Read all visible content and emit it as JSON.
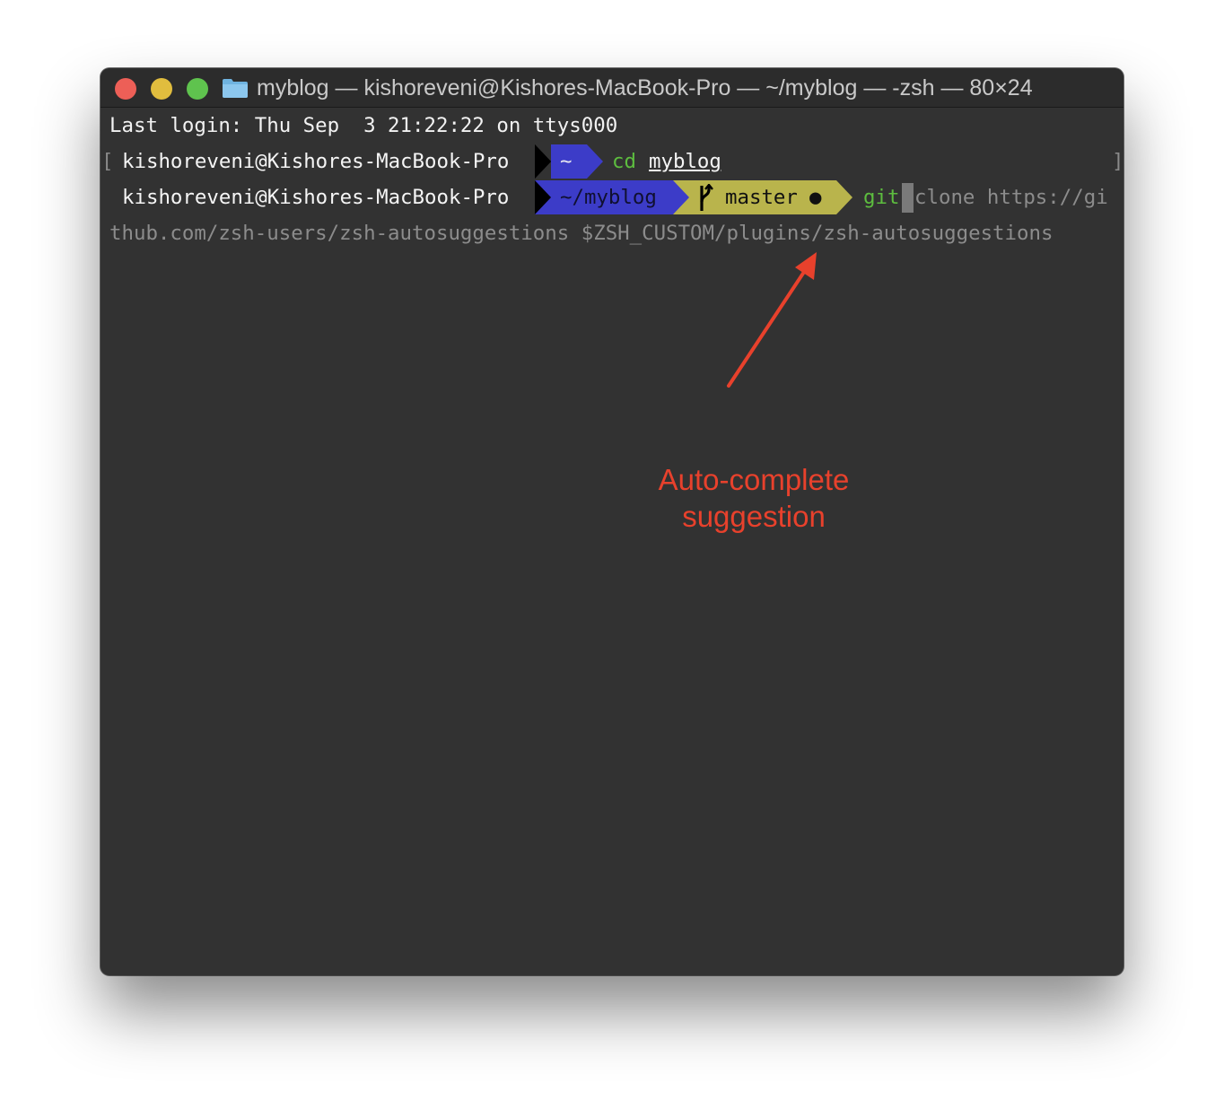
{
  "window": {
    "title": "myblog — kishoreveni@Kishores-MacBook-Pro — ~/myblog — -zsh — 80×24"
  },
  "terminal": {
    "last_login": "Last login: Thu Sep  3 21:22:22 on ttys000",
    "prompt1": {
      "left_bracket": "[",
      "user_host": "kishoreveni@Kishores-MacBook-Pro",
      "dir": "~",
      "cmd": "cd",
      "arg": "myblog",
      "right_bracket": "]"
    },
    "prompt2": {
      "user_host": "kishoreveni@Kishores-MacBook-Pro",
      "dir": "~/myblog",
      "branch_icon": "git-branch-icon",
      "branch": "master",
      "dirty_marker": "●",
      "typed_cmd": "git",
      "suggestion_part1": "clone https://gi",
      "suggestion_part2": "thub.com/zsh-users/zsh-autosuggestions $ZSH_CUSTOM/plugins/zsh-autosuggestions"
    }
  },
  "annotation": {
    "line1": "Auto-complete",
    "line2": "suggestion",
    "color": "#e8412c"
  },
  "colors": {
    "terminal_bg": "#323232",
    "dir_segment": "#3c3cc8",
    "git_segment": "#b9b44c",
    "command_green": "#5dbd3f",
    "suggestion_gray": "#8c8c8c"
  }
}
